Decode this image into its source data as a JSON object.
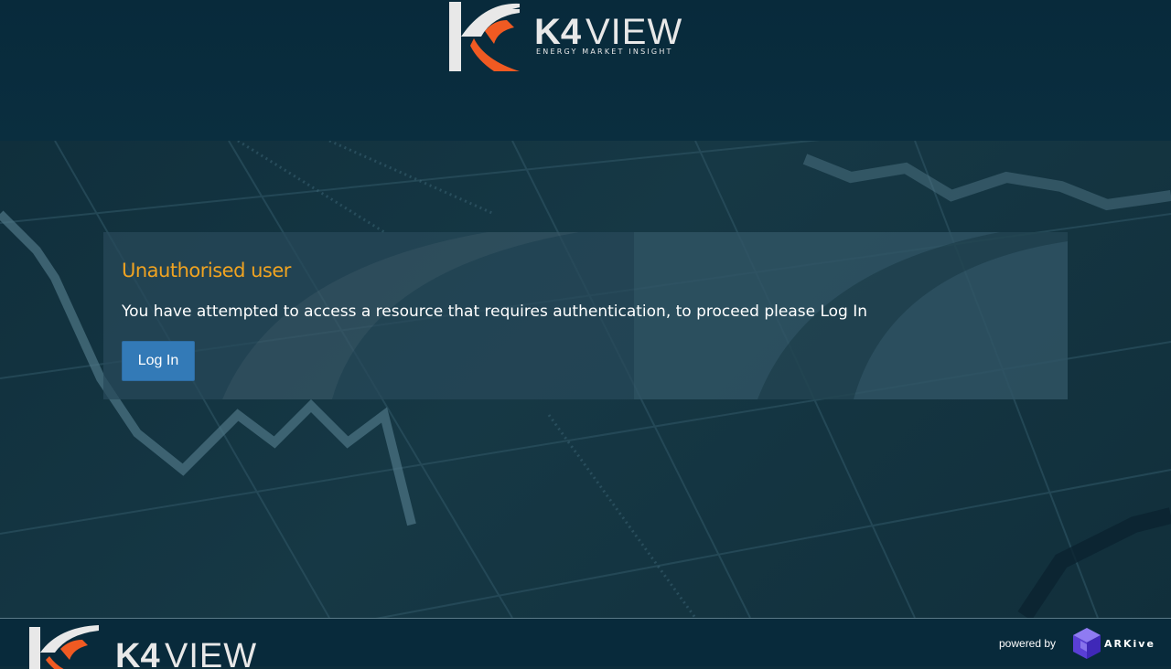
{
  "brand": {
    "name_bold": "K4",
    "name_light": "VIEW",
    "tagline": "ENERGY MARKET INSIGHT",
    "colors": {
      "orange": "#f05a22",
      "white": "#e8e8e8",
      "header_bg": "#082a3b"
    }
  },
  "panel": {
    "title": "Unauthorised user",
    "message": "You have attempted to access a resource that requires authentication, to proceed please Log In",
    "login_label": "Log In",
    "title_color": "#f0a321",
    "button_color": "#337ab7"
  },
  "footer": {
    "brand_bold": "K4",
    "brand_light": "VIEW",
    "powered_by": "powered by",
    "partner": "ARKive",
    "partner_color": "#6b4de6"
  }
}
